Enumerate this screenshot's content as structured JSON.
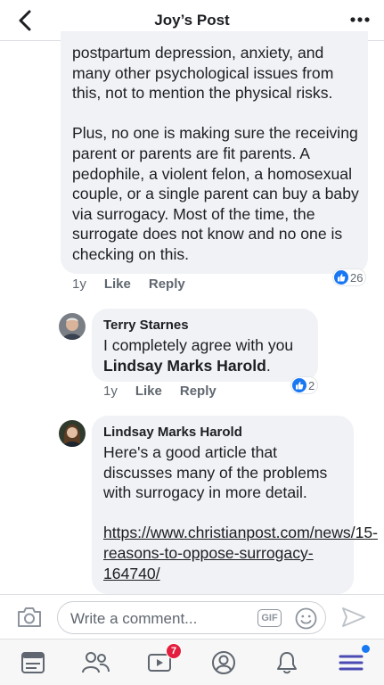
{
  "header": {
    "title": "Joy’s Post",
    "back_icon": "back-arrow-icon",
    "more_icon": "more-dots-icon"
  },
  "main_comment": {
    "paragraph1": "postpartum depression, anxiety, and many other psychological issues from this, not to mention the physical risks.",
    "paragraph2": "Plus, no one is making sure the receiving parent or parents are fit parents. A pedophile, a violent felon, a homosexual couple, or a single parent can buy a baby via surrogacy. Most of the time, the surrogate does not know and no one is checking on this.",
    "time": "1y",
    "like_label": "Like",
    "reply_label": "Reply",
    "reaction_count": "26"
  },
  "reply1": {
    "author": "Terry Starnes",
    "text": "I completely agree with you ",
    "mention": "Lindsay Marks Harold",
    "text_end": ".",
    "time": "1y",
    "like_label": "Like",
    "reply_label": "Reply",
    "reaction_count": "2"
  },
  "reply2": {
    "author": "Lindsay Marks Harold",
    "text": "Here's a good article that discusses many of the problems with surrogacy in more detail.",
    "link": "https://www.christianpost.com/news/15-reasons-to-oppose-surrogacy-164740/"
  },
  "composer": {
    "placeholder": "Write a comment...",
    "gif_label": "GIF"
  },
  "tabbar": {
    "video_badge": "7"
  },
  "colors": {
    "accent": "#1877f2",
    "bubble": "#f0f2f5",
    "badge": "#e41e3f",
    "tabbar_icon": "#606770",
    "menu_icon": "#4b4bb3"
  }
}
